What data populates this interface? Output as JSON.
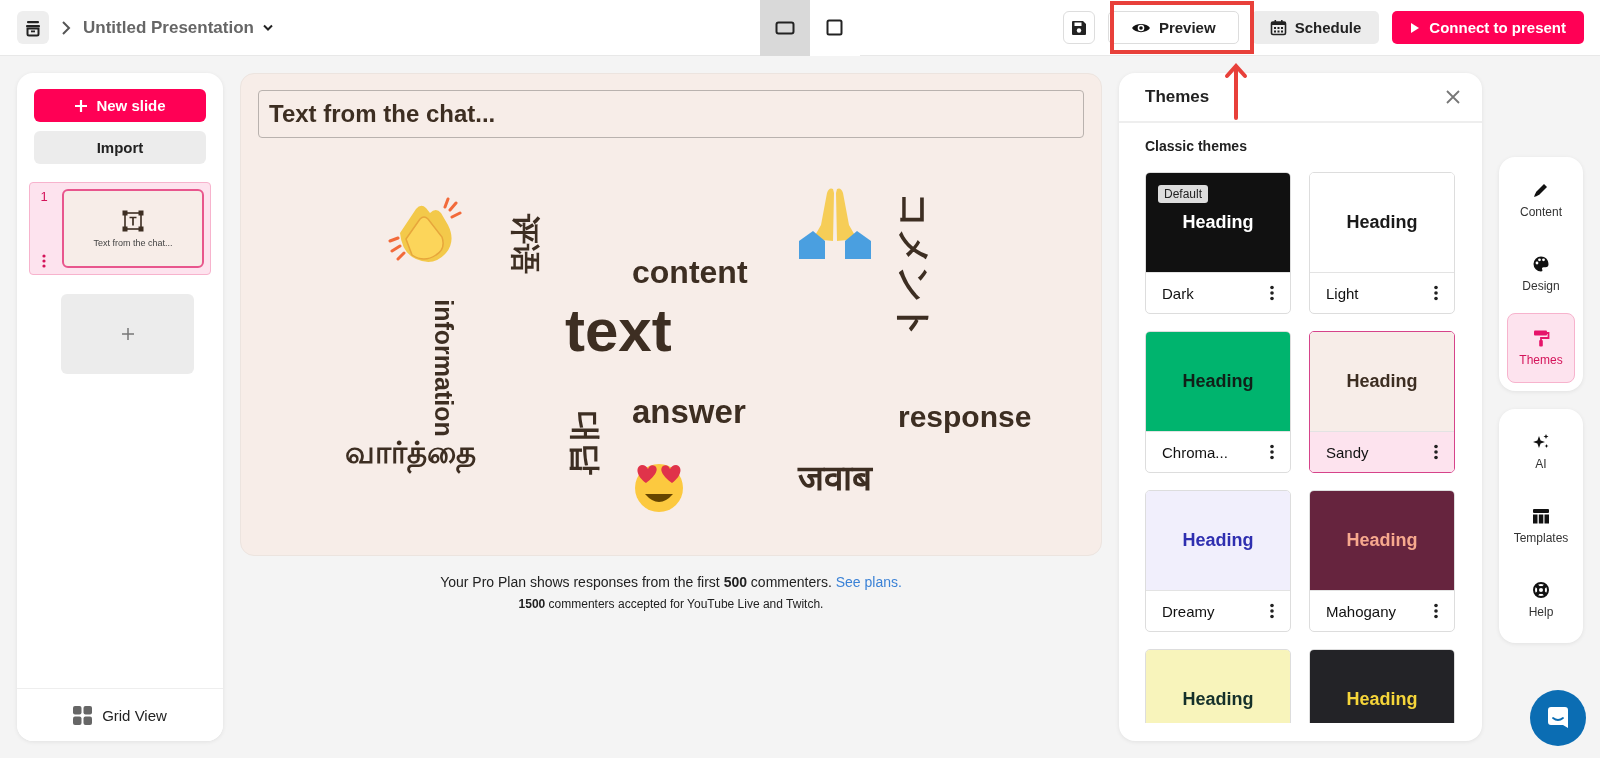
{
  "topbar": {
    "title": "Untitled Presentation",
    "layout_options": [
      {
        "selected": true
      },
      {
        "selected": false
      }
    ],
    "preview": "Preview",
    "schedule": "Schedule",
    "connect": "Connect to present"
  },
  "slides_panel": {
    "new_slide": "New slide",
    "import": "Import",
    "slides": [
      {
        "number": "1",
        "title": "Text from the chat...",
        "selected": true
      }
    ],
    "grid_view": "Grid View"
  },
  "slide": {
    "prompt": "Text from the chat...",
    "words": [
      {
        "text": "评语",
        "kind": "rotated"
      },
      {
        "text": "information",
        "kind": "rotated"
      },
      {
        "text": "வார்த்தை",
        "kind": "word"
      },
      {
        "text": "content",
        "kind": "word"
      },
      {
        "text": "text",
        "kind": "word"
      },
      {
        "text": "대답",
        "kind": "rotated"
      },
      {
        "text": "answer",
        "kind": "word"
      },
      {
        "text": "コメント",
        "kind": "rotated"
      },
      {
        "text": "response",
        "kind": "word"
      },
      {
        "text": "जवाब",
        "kind": "word"
      }
    ],
    "note": "Your Pro Plan shows responses from the first **500** commenters.",
    "note_link": "See plans.",
    "note_2": "**1500** commenters accepted for YouTube Live and Twitch."
  },
  "themes_panel": {
    "title": "Themes",
    "section": "Classic themes",
    "themes": [
      {
        "name": "Dark",
        "badge": "Default",
        "heading": {
          "text": "Heading",
          "color": "#ffffff"
        },
        "color": "#111111",
        "selected": false
      },
      {
        "name": "Light",
        "heading": {
          "text": "Heading",
          "color": "#1a1a1a"
        },
        "color": "#ffffff",
        "selected": false
      },
      {
        "name": "Chroma...",
        "heading": {
          "text": "Heading",
          "color": "#102018"
        },
        "color": "#00b46e",
        "selected": false
      },
      {
        "name": "Sandy",
        "heading": {
          "text": "Heading",
          "color": "#3d2e22"
        },
        "color": "#f7ede8",
        "selected": true
      },
      {
        "name": "Dreamy",
        "heading": {
          "text": "Heading",
          "color": "#2f2fb0"
        },
        "color": "#f1effc",
        "selected": false
      },
      {
        "name": "Mahogany",
        "heading": {
          "text": "Heading",
          "color": "#f7a98e"
        },
        "color": "#66243e",
        "selected": false
      },
      {
        "heading": {
          "text": "Heading",
          "color": "#15302a"
        },
        "color": "#f8f4bb",
        "selected": false
      },
      {
        "heading": {
          "text": "Heading",
          "color": "#f5d53a"
        },
        "color": "#232327",
        "selected": false
      }
    ]
  },
  "rail": [
    [
      {
        "label": "Content",
        "selected": false
      },
      {
        "label": "Design",
        "selected": false
      },
      {
        "label": "Themes",
        "selected": true
      }
    ],
    [
      {
        "label": "AI",
        "selected": false
      },
      {
        "label": "Templates",
        "selected": false
      },
      {
        "label": "Help",
        "selected": false
      }
    ]
  ]
}
